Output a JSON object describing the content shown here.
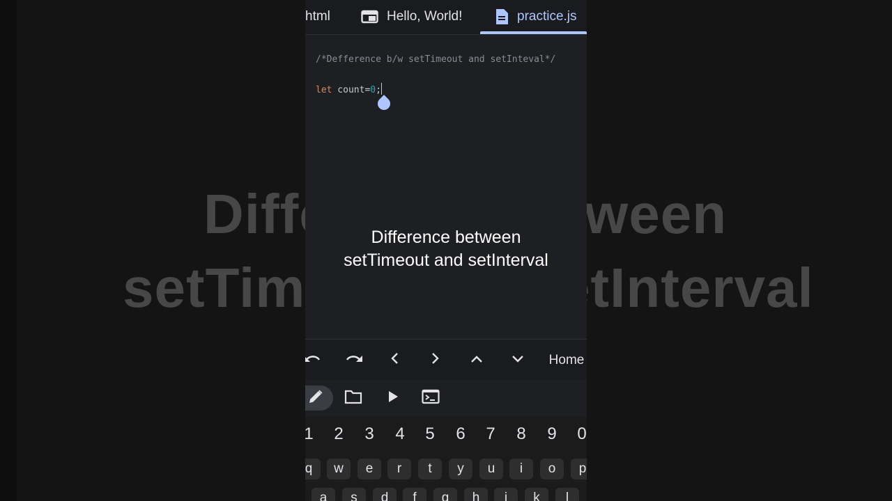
{
  "background_caption": {
    "line1": "Difference between",
    "line2": "setTimeout and setInterval",
    "left_line1": "Diffe",
    "left_line2": "setTime",
    "right_line1": "ween",
    "right_line2": "etInterval"
  },
  "tabs": [
    {
      "label": "html",
      "icon": "none"
    },
    {
      "label": "Hello, World!",
      "icon": "web-preview-icon"
    },
    {
      "label": "practice.js",
      "icon": "document-icon",
      "active": true
    }
  ],
  "editor": {
    "comment": "/*Defference b/w setTimeout and setInteval*/",
    "code_kw": "let",
    "code_ident": " count=",
    "code_num": "0",
    "code_end": ";"
  },
  "caption": {
    "line1": "Difference between",
    "line2": "setTimeout and setInterval"
  },
  "navbar": {
    "home_label": "Home",
    "icons": [
      "undo-icon",
      "redo-icon",
      "arrow-left-icon",
      "arrow-right-icon",
      "arrow-up-icon",
      "arrow-down-icon"
    ]
  },
  "toolbar": {
    "icons": [
      "pencil-icon",
      "folder-icon",
      "play-icon",
      "terminal-icon"
    ]
  },
  "keyboard": {
    "numbers": [
      "1",
      "2",
      "3",
      "4",
      "5",
      "6",
      "7",
      "8",
      "9",
      "0"
    ],
    "row1": [
      "q",
      "w",
      "e",
      "r",
      "t",
      "y",
      "u",
      "i",
      "o",
      "p"
    ],
    "row2": [
      "a",
      "s",
      "d",
      "f",
      "g",
      "h",
      "j",
      "k",
      "l"
    ]
  },
  "colors": {
    "accent": "#aec6ff",
    "keyword": "#cf8e6d",
    "number": "#2aacb8",
    "comment": "#8a8d93"
  }
}
